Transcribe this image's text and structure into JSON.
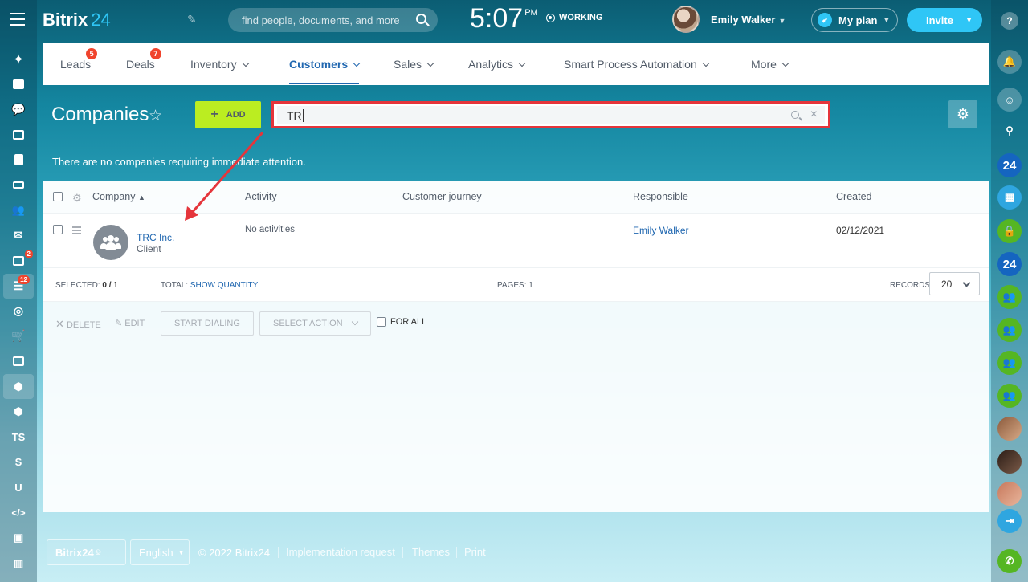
{
  "app": {
    "logo_name": "Bitrix",
    "logo_num": "24"
  },
  "header": {
    "search_placeholder": "find people, documents, and more",
    "time": "5:07",
    "ampm": "PM",
    "status": "WORKING",
    "user_name": "Emily Walker",
    "my_plan": "My plan",
    "invite": "Invite"
  },
  "tabs": [
    {
      "label": "Leads",
      "badge": "5"
    },
    {
      "label": "Deals",
      "badge": "7"
    },
    {
      "label": "Inventory"
    },
    {
      "label": "Customers",
      "active": true
    },
    {
      "label": "Sales"
    },
    {
      "label": "Analytics"
    },
    {
      "label": "Smart Process Automation"
    },
    {
      "label": "More"
    }
  ],
  "page": {
    "title": "Companies",
    "add_label": "ADD",
    "filter_value": "TR",
    "notice": "There are no companies requiring immediate attention."
  },
  "grid": {
    "columns": [
      "Company",
      "Activity",
      "Customer journey",
      "Responsible",
      "Created"
    ],
    "rows": [
      {
        "company": "TRC Inc.",
        "type": "Client",
        "activity": "No activities",
        "journey": "",
        "responsible": "Emily Walker",
        "created": "02/12/2021"
      }
    ],
    "footer": {
      "selected_label": "SELECTED:",
      "selected_value": "0 / 1",
      "total_label": "TOTAL:",
      "total_value": "SHOW QUANTITY",
      "pages_label": "PAGES:",
      "pages_value": "1",
      "records_label": "RECORDS:",
      "records_value": "20"
    },
    "actions": {
      "delete": "DELETE",
      "edit": "EDIT",
      "start_dialing": "START DIALING",
      "select_action": "SELECT ACTION",
      "for_all": "FOR ALL"
    }
  },
  "left_sidebar": {
    "badges": {
      "tasks": "2",
      "crm": "12"
    },
    "text_items": [
      "TS",
      "S",
      "U"
    ]
  },
  "right_sidebar": {
    "b24_label": "24"
  },
  "footer": {
    "brand": "Bitrix24",
    "language": "English",
    "copyright": "© 2022 Bitrix24",
    "links": [
      "Implementation request",
      "Themes",
      "Print"
    ]
  },
  "colors": {
    "accent": "#2fc6f6",
    "add_button": "#bbed21",
    "highlight": "#e5353b",
    "link": "#2067b0"
  }
}
